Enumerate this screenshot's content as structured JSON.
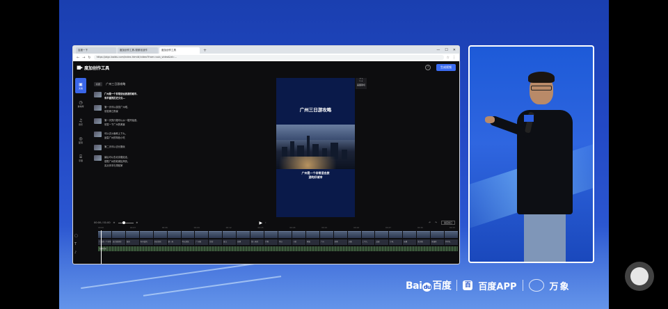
{
  "browser": {
    "tabs": [
      {
        "label": "百度一下"
      },
      {
        "label": "度加创作工具-视频化创作"
      },
      {
        "label": "度加创作工具"
      }
    ],
    "url": "https://aigc.baidu.com/index.html#/video?from=sub_video&id=..."
  },
  "app": {
    "name": "度加创作工具",
    "export_label": "生成视频",
    "rail": [
      {
        "icon": "▣",
        "label": "文案"
      },
      {
        "icon": "◷",
        "label": "素材库"
      },
      {
        "icon": "♫",
        "label": "音乐"
      },
      {
        "icon": "◎",
        "label": "配音"
      },
      {
        "icon": "⌸",
        "label": "字幕"
      }
    ],
    "script": {
      "badge": "标题",
      "head": "广州三日游攻略",
      "paragraphs": [
        {
          "lines": [
            "广州是一个非常适合旅游的城市，",
            "有丰富的历史文化…"
          ],
          "bold": true
        },
        {
          "lines": [
            "第一天可以游览广州塔，",
            "欣赏珠江夜景"
          ],
          "bold": false
        },
        {
          "lines": [
            "第一天的行程可以从一楼开始逛，",
            "欣赏一下广州的美景"
          ],
          "bold": false
        },
        {
          "lines": [
            "可以去沙面和上下九，",
            "品尝广州的特色小吃"
          ],
          "bold": false
        },
        {
          "lines": [
            "第二天可以去长隆玩"
          ],
          "bold": false
        },
        {
          "lines": [
            "最后可以去北京路走走，",
            "感受广州的老城区风情，",
            "买点伴手礼带回家"
          ],
          "bold": false
        }
      ]
    },
    "preview": {
      "title": "广州三日游攻略",
      "subtitle_lines": [
        "广州是一个非常适合旅",
        "游的好城市"
      ],
      "crop_label": "画面裁切"
    },
    "timeline": {
      "time": "00:00 / 01:00",
      "ratio": "适应窗口",
      "ruler": [
        "00:00",
        "00:03",
        "00:06",
        "00:09",
        "00:12",
        "00:15",
        "00:18",
        "00:21",
        "00:24",
        "00:27",
        "00:30",
        "00:33"
      ],
      "subtitles": [
        "广州是一个非常",
        "适合旅游的",
        "城市",
        "有丰富的",
        "历史文化",
        "第一天",
        "可以游览",
        "广州塔",
        "欣赏",
        "珠江",
        "夜景",
        "第一天的",
        "行程",
        "可以",
        "一楼",
        "开始",
        "广州",
        "美景",
        "沙面",
        "上下九",
        "品尝",
        "小吃",
        "长隆",
        "北京路",
        "老城区",
        "伴手礼"
      ],
      "audio_label": "背景音乐"
    }
  },
  "brand": {
    "baidu_left": "Bai",
    "baidu_right": "百度",
    "paw": "du",
    "app_icon": "百",
    "app_text": "百度APP",
    "wanxiang": "万象"
  }
}
